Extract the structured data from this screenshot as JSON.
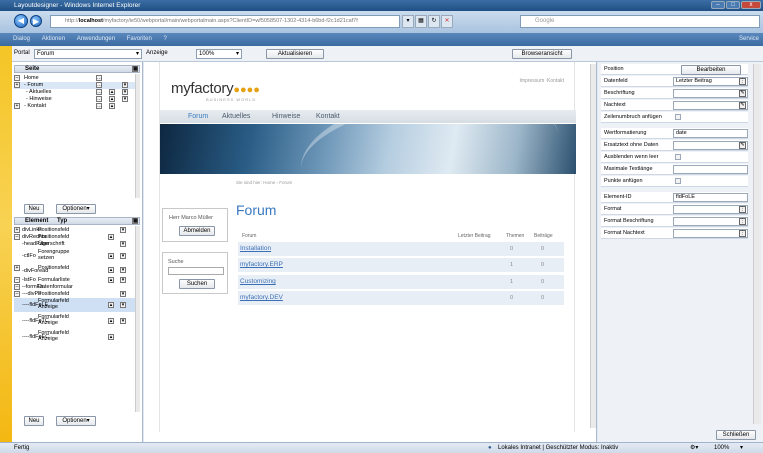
{
  "window": {
    "title": "Layoutdesigner - Windows Internet Explorer",
    "controls": [
      "–",
      "□",
      "x"
    ]
  },
  "browser": {
    "url_prefix": "http://",
    "url_host": "localhost",
    "url_path": "/myfactory/ie50/webportal/main/webportalmain.aspx?ClientID=wf5058507-1302-4314-b6bd-f2c1d21caf7f",
    "search_placeholder": "Google"
  },
  "menu": {
    "items": [
      "Dialog",
      "Aktionen",
      "Anwendungen",
      "Favoriten",
      "?"
    ],
    "service": "Service"
  },
  "toolbar": {
    "portal_label": "Portal",
    "portal_value": "Forum",
    "anzeige_label": "Anzeige",
    "zoom_value": "100%",
    "refresh_button": "Aktualisieren",
    "browser_view_button": "Browseransicht"
  },
  "left_pane": {
    "pages_header": "Seite",
    "pages": [
      "Home",
      "- Forum",
      "- Aktuelles",
      "- Hinweise",
      "- Kontakt"
    ],
    "new_button": "Neu",
    "options_button": "Optionen▾",
    "elements_header": {
      "element": "Element",
      "type": "Typ"
    },
    "elements": [
      {
        "name": "divLinks",
        "type": "Positionsfeld"
      },
      {
        "name": "divRechts",
        "type": "Positionsfeld"
      },
      {
        "name": "-headPage",
        "type": "Überschrift"
      },
      {
        "name": "-ctlFo",
        "type": "Forengruppe setzen"
      },
      {
        "name": "-divForead",
        "type": "Positionsfeld"
      },
      {
        "name": "-lstFo",
        "type": "Formularliste"
      },
      {
        "name": "--formFo",
        "type": "Datenformular"
      },
      {
        "name": "---divPo",
        "type": "Positionsfeld"
      },
      {
        "name": "----fldFoLE",
        "type": "Formularfeld Anzeige"
      },
      {
        "name": "----fldFoTC",
        "type": "Formularfeld Anzeige"
      },
      {
        "name": "----fldFoEC",
        "type": "Formularfeld Anzeige"
      }
    ],
    "new_button_2": "Neu",
    "options_button_2": "Optionen▾"
  },
  "site": {
    "logo_main": "myfactory",
    "logo_dots": "●●●●",
    "logo_sub": "BUSINESS WORLD",
    "impressum": "Impressum",
    "kontakt_link": "Kontakt",
    "nav": [
      "Forum",
      "Aktuelles",
      "Hinweise",
      "Kontakt"
    ],
    "breadcrumb": "Sie sind hier: Home › Forum",
    "user_name": "Herr Marco Müller",
    "logout_button": "Abmelden",
    "search_label": "Suche",
    "search_button": "Suchen",
    "heading": "Forum",
    "table_headers": {
      "forum": "Forum",
      "last": "Letzter Beitrag",
      "topics": "Themen",
      "posts": "Beiträge"
    },
    "rows": [
      {
        "name": "Installation",
        "topics": "0",
        "posts": "0"
      },
      {
        "name": "myfactory.ERP",
        "topics": "1",
        "posts": "0"
      },
      {
        "name": "Customizing",
        "topics": "1",
        "posts": "0"
      },
      {
        "name": "myfactory.DEV",
        "topics": "0",
        "posts": "0"
      }
    ]
  },
  "properties": {
    "position_label": "Position",
    "edit_button": "Bearbeiten",
    "datenfeld_label": "Datenfeld",
    "datenfeld_value": "Letzter Beitrag",
    "beschriftung_label": "Beschriftung",
    "nachtext_label": "Nachtext",
    "zeilenumbruch_label": "Zeilenumbruch anfügen",
    "wertformatierung_label": "Wertformatierung",
    "wertformatierung_value": "date",
    "ersatztext_label": "Ersatztext ohne Daten",
    "ausblenden_label": "Ausblenden wenn leer",
    "maxlaenge_label": "Maximale Textlänge",
    "punkte_label": "Punkte anfügen",
    "element_id_label": "Element-ID",
    "element_id_value": "fldFoLE",
    "format_label": "Format",
    "format_beschriftung_label": "Format Beschriftung",
    "format_nachtext_label": "Format Nachtext",
    "close_button": "Schließen"
  },
  "status": {
    "left": "Fertig",
    "zone": "Lokales Intranet | Geschützter Modus: Inaktiv",
    "zoom": "100%"
  }
}
